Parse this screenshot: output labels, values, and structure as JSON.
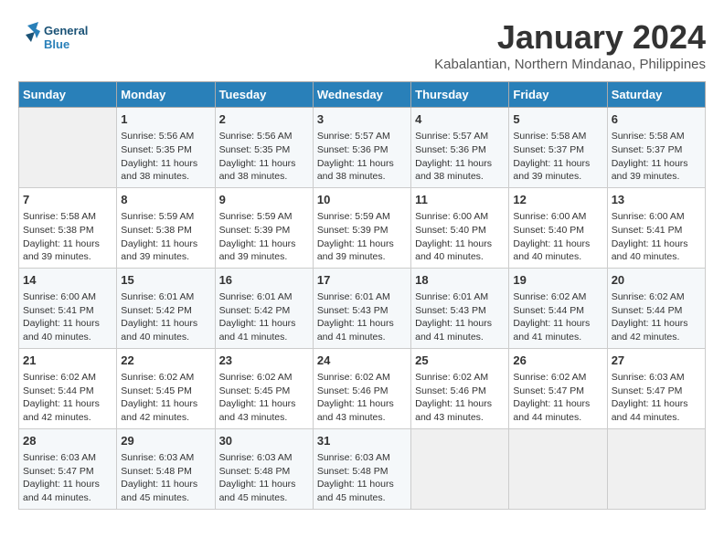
{
  "header": {
    "logo_line1": "General",
    "logo_line2": "Blue",
    "month_title": "January 2024",
    "location": "Kabalantian, Northern Mindanao, Philippines"
  },
  "days_of_week": [
    "Sunday",
    "Monday",
    "Tuesday",
    "Wednesday",
    "Thursday",
    "Friday",
    "Saturday"
  ],
  "weeks": [
    [
      {
        "day": "",
        "content": ""
      },
      {
        "day": "1",
        "content": "Sunrise: 5:56 AM\nSunset: 5:35 PM\nDaylight: 11 hours\nand 38 minutes."
      },
      {
        "day": "2",
        "content": "Sunrise: 5:56 AM\nSunset: 5:35 PM\nDaylight: 11 hours\nand 38 minutes."
      },
      {
        "day": "3",
        "content": "Sunrise: 5:57 AM\nSunset: 5:36 PM\nDaylight: 11 hours\nand 38 minutes."
      },
      {
        "day": "4",
        "content": "Sunrise: 5:57 AM\nSunset: 5:36 PM\nDaylight: 11 hours\nand 38 minutes."
      },
      {
        "day": "5",
        "content": "Sunrise: 5:58 AM\nSunset: 5:37 PM\nDaylight: 11 hours\nand 39 minutes."
      },
      {
        "day": "6",
        "content": "Sunrise: 5:58 AM\nSunset: 5:37 PM\nDaylight: 11 hours\nand 39 minutes."
      }
    ],
    [
      {
        "day": "7",
        "content": "Sunrise: 5:58 AM\nSunset: 5:38 PM\nDaylight: 11 hours\nand 39 minutes."
      },
      {
        "day": "8",
        "content": "Sunrise: 5:59 AM\nSunset: 5:38 PM\nDaylight: 11 hours\nand 39 minutes."
      },
      {
        "day": "9",
        "content": "Sunrise: 5:59 AM\nSunset: 5:39 PM\nDaylight: 11 hours\nand 39 minutes."
      },
      {
        "day": "10",
        "content": "Sunrise: 5:59 AM\nSunset: 5:39 PM\nDaylight: 11 hours\nand 39 minutes."
      },
      {
        "day": "11",
        "content": "Sunrise: 6:00 AM\nSunset: 5:40 PM\nDaylight: 11 hours\nand 40 minutes."
      },
      {
        "day": "12",
        "content": "Sunrise: 6:00 AM\nSunset: 5:40 PM\nDaylight: 11 hours\nand 40 minutes."
      },
      {
        "day": "13",
        "content": "Sunrise: 6:00 AM\nSunset: 5:41 PM\nDaylight: 11 hours\nand 40 minutes."
      }
    ],
    [
      {
        "day": "14",
        "content": "Sunrise: 6:00 AM\nSunset: 5:41 PM\nDaylight: 11 hours\nand 40 minutes."
      },
      {
        "day": "15",
        "content": "Sunrise: 6:01 AM\nSunset: 5:42 PM\nDaylight: 11 hours\nand 40 minutes."
      },
      {
        "day": "16",
        "content": "Sunrise: 6:01 AM\nSunset: 5:42 PM\nDaylight: 11 hours\nand 41 minutes."
      },
      {
        "day": "17",
        "content": "Sunrise: 6:01 AM\nSunset: 5:43 PM\nDaylight: 11 hours\nand 41 minutes."
      },
      {
        "day": "18",
        "content": "Sunrise: 6:01 AM\nSunset: 5:43 PM\nDaylight: 11 hours\nand 41 minutes."
      },
      {
        "day": "19",
        "content": "Sunrise: 6:02 AM\nSunset: 5:44 PM\nDaylight: 11 hours\nand 41 minutes."
      },
      {
        "day": "20",
        "content": "Sunrise: 6:02 AM\nSunset: 5:44 PM\nDaylight: 11 hours\nand 42 minutes."
      }
    ],
    [
      {
        "day": "21",
        "content": "Sunrise: 6:02 AM\nSunset: 5:44 PM\nDaylight: 11 hours\nand 42 minutes."
      },
      {
        "day": "22",
        "content": "Sunrise: 6:02 AM\nSunset: 5:45 PM\nDaylight: 11 hours\nand 42 minutes."
      },
      {
        "day": "23",
        "content": "Sunrise: 6:02 AM\nSunset: 5:45 PM\nDaylight: 11 hours\nand 43 minutes."
      },
      {
        "day": "24",
        "content": "Sunrise: 6:02 AM\nSunset: 5:46 PM\nDaylight: 11 hours\nand 43 minutes."
      },
      {
        "day": "25",
        "content": "Sunrise: 6:02 AM\nSunset: 5:46 PM\nDaylight: 11 hours\nand 43 minutes."
      },
      {
        "day": "26",
        "content": "Sunrise: 6:02 AM\nSunset: 5:47 PM\nDaylight: 11 hours\nand 44 minutes."
      },
      {
        "day": "27",
        "content": "Sunrise: 6:03 AM\nSunset: 5:47 PM\nDaylight: 11 hours\nand 44 minutes."
      }
    ],
    [
      {
        "day": "28",
        "content": "Sunrise: 6:03 AM\nSunset: 5:47 PM\nDaylight: 11 hours\nand 44 minutes."
      },
      {
        "day": "29",
        "content": "Sunrise: 6:03 AM\nSunset: 5:48 PM\nDaylight: 11 hours\nand 45 minutes."
      },
      {
        "day": "30",
        "content": "Sunrise: 6:03 AM\nSunset: 5:48 PM\nDaylight: 11 hours\nand 45 minutes."
      },
      {
        "day": "31",
        "content": "Sunrise: 6:03 AM\nSunset: 5:48 PM\nDaylight: 11 hours\nand 45 minutes."
      },
      {
        "day": "",
        "content": ""
      },
      {
        "day": "",
        "content": ""
      },
      {
        "day": "",
        "content": ""
      }
    ]
  ]
}
